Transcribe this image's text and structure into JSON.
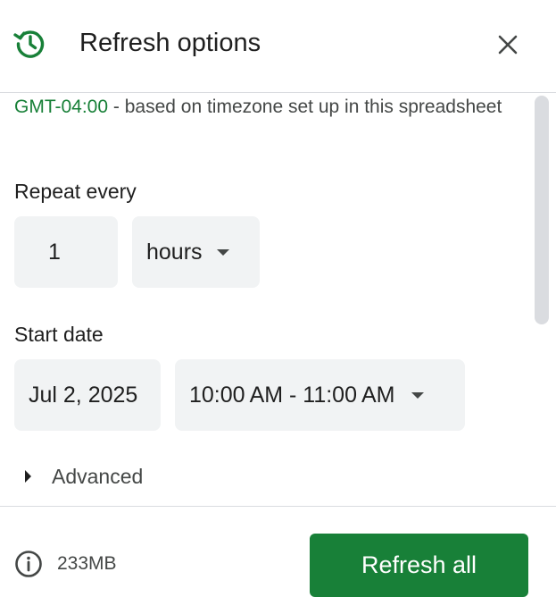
{
  "header": {
    "title": "Refresh options",
    "icon": "clock-refresh-icon",
    "close_icon": "close-icon"
  },
  "timezone": {
    "tz": "GMT-04:00",
    "description": " - based on timezone set up in this spreadsheet"
  },
  "repeat": {
    "label": "Repeat every",
    "count": "1",
    "unit": "hours"
  },
  "start": {
    "label": "Start date",
    "date": "Jul 2, 2025",
    "time_range": "10:00 AM - 11:00 AM"
  },
  "advanced": {
    "label": "Advanced"
  },
  "footer": {
    "size": "233MB",
    "refresh_label": "Refresh all"
  },
  "colors": {
    "accent": "#188038",
    "field_bg": "#f1f3f4",
    "text": "#1f1f1f",
    "muted": "#444746"
  }
}
